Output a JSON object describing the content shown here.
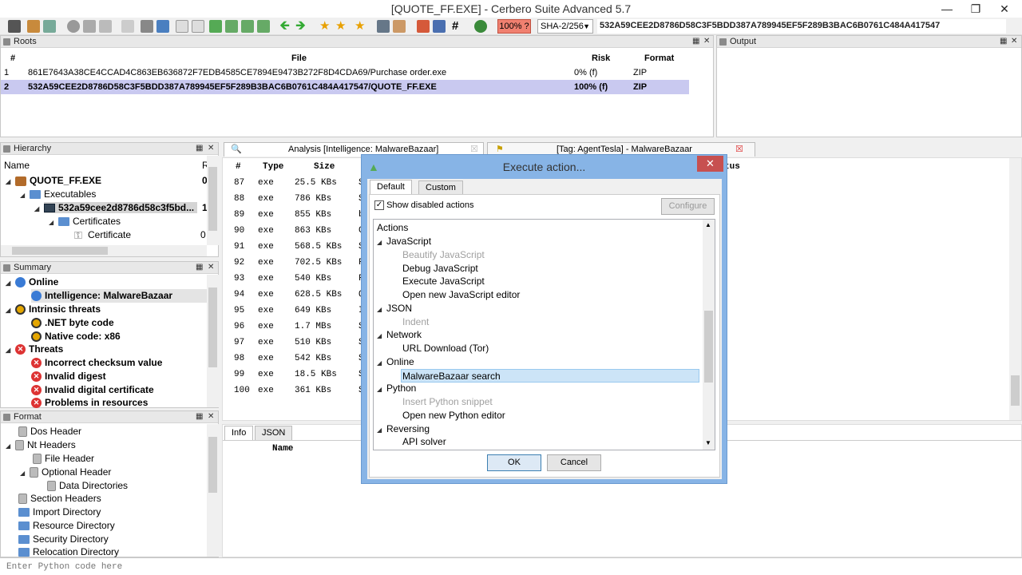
{
  "window": {
    "title": "[QUOTE_FF.EXE] - Cerbero Suite Advanced 5.7"
  },
  "toolbar": {
    "risk_label": "100% ?",
    "hash_algo": "SHA-2/256",
    "hash_value": "532A59CEE2D8786D58C3F5BDD387A789945EF5F289B3BAC6B0761C484A417547"
  },
  "roots": {
    "title": "Roots",
    "columns": {
      "num": "#",
      "file": "File",
      "risk": "Risk",
      "format": "Format"
    },
    "rows": [
      {
        "num": "1",
        "file": "861E7643A38CE4CCAD4C863EB636872F7EDB4585CE7894E9473B272F8D4CDA69/Purchase order.exe",
        "risk": "0% (f)",
        "format": "ZIP"
      },
      {
        "num": "2",
        "file": "532A59CEE2D8786D58C3F5BDD387A789945EF5F289B3BAC6B0761C484A417547/QUOTE_FF.EXE",
        "risk": "100% (f)",
        "format": "ZIP"
      }
    ]
  },
  "output": {
    "title": "Output"
  },
  "hierarchy": {
    "title": "Hierarchy",
    "col_name": "Name",
    "col_r": "R",
    "items": [
      {
        "label": "QUOTE_FF.EXE",
        "risk": "0"
      },
      {
        "label": "Executables",
        "risk": ""
      },
      {
        "label": "532a59cee2d8786d58c3f5bd...",
        "risk": "1"
      },
      {
        "label": "Certificates",
        "risk": ""
      },
      {
        "label": "Certificate",
        "risk": "0"
      }
    ]
  },
  "summary": {
    "title": "Summary",
    "items": [
      {
        "label": "Online"
      },
      {
        "label": "Intelligence: MalwareBazaar"
      },
      {
        "label": "Intrinsic threats"
      },
      {
        "label": ".NET byte code"
      },
      {
        "label": "Native code: x86"
      },
      {
        "label": "Threats"
      },
      {
        "label": "Incorrect checksum value"
      },
      {
        "label": "Invalid digest"
      },
      {
        "label": "Invalid digital certificate"
      },
      {
        "label": "Problems in resources"
      }
    ]
  },
  "format": {
    "title": "Format",
    "items": [
      {
        "label": "Dos Header"
      },
      {
        "label": "Nt Headers"
      },
      {
        "label": "File Header"
      },
      {
        "label": "Optional Header"
      },
      {
        "label": "Data Directories"
      },
      {
        "label": "Section Headers"
      },
      {
        "label": "Import Directory"
      },
      {
        "label": "Resource Directory"
      },
      {
        "label": "Security Directory"
      },
      {
        "label": "Relocation Directory"
      }
    ]
  },
  "center": {
    "tab1": "Analysis [Intelligence: MalwareBazaar]",
    "tab2": "[Tag: AgentTesla] - MalwareBazaar",
    "columns": {
      "num": "#",
      "type": "Type",
      "size": "Size",
      "status": "tus"
    },
    "rows": [
      {
        "num": "87",
        "type": "exe",
        "size": "25.5 KBs",
        "s": "S"
      },
      {
        "num": "88",
        "type": "exe",
        "size": "786 KBs",
        "s": "S"
      },
      {
        "num": "89",
        "type": "exe",
        "size": "855 KBs",
        "s": "b"
      },
      {
        "num": "90",
        "type": "exe",
        "size": "863 KBs",
        "s": "C"
      },
      {
        "num": "91",
        "type": "exe",
        "size": "568.5 KBs",
        "s": "S"
      },
      {
        "num": "92",
        "type": "exe",
        "size": "702.5 KBs",
        "s": "F"
      },
      {
        "num": "93",
        "type": "exe",
        "size": "540 KBs",
        "s": "F"
      },
      {
        "num": "94",
        "type": "exe",
        "size": "628.5 KBs",
        "s": "Q"
      },
      {
        "num": "95",
        "type": "exe",
        "size": "649 KBs",
        "s": "I"
      },
      {
        "num": "96",
        "type": "exe",
        "size": "1.7 MBs",
        "s": "S"
      },
      {
        "num": "97",
        "type": "exe",
        "size": "510 KBs",
        "s": "S"
      },
      {
        "num": "98",
        "type": "exe",
        "size": "542 KBs",
        "s": "S"
      },
      {
        "num": "99",
        "type": "exe",
        "size": "18.5 KBs",
        "s": "S"
      },
      {
        "num": "100",
        "type": "exe",
        "size": "361 KBs",
        "s": "S"
      }
    ],
    "info_tab": "Info",
    "json_tab": "JSON",
    "info_col": "Name"
  },
  "dialog": {
    "title": "Execute action...",
    "tab_default": "Default",
    "tab_custom": "Custom",
    "show_disabled": "Show disabled actions",
    "configure": "Configure",
    "actions_header": "Actions",
    "ok": "OK",
    "cancel": "Cancel",
    "actions": [
      {
        "label": "JavaScript",
        "kind": "group"
      },
      {
        "label": "Beautify JavaScript",
        "kind": "disabled"
      },
      {
        "label": "Debug JavaScript",
        "kind": "item"
      },
      {
        "label": "Execute JavaScript",
        "kind": "item"
      },
      {
        "label": "Open new JavaScript editor",
        "kind": "item"
      },
      {
        "label": "JSON",
        "kind": "group"
      },
      {
        "label": "Indent",
        "kind": "disabled"
      },
      {
        "label": "Network",
        "kind": "group"
      },
      {
        "label": "URL Download (Tor)",
        "kind": "item"
      },
      {
        "label": "Online",
        "kind": "group"
      },
      {
        "label": "MalwareBazaar search",
        "kind": "selected"
      },
      {
        "label": "Python",
        "kind": "group"
      },
      {
        "label": "Insert Python snippet",
        "kind": "disabled"
      },
      {
        "label": "Open new Python editor",
        "kind": "item"
      },
      {
        "label": "Reversing",
        "kind": "group"
      },
      {
        "label": "API solver",
        "kind": "item"
      }
    ]
  },
  "command": {
    "placeholder": "Enter Python code here"
  }
}
